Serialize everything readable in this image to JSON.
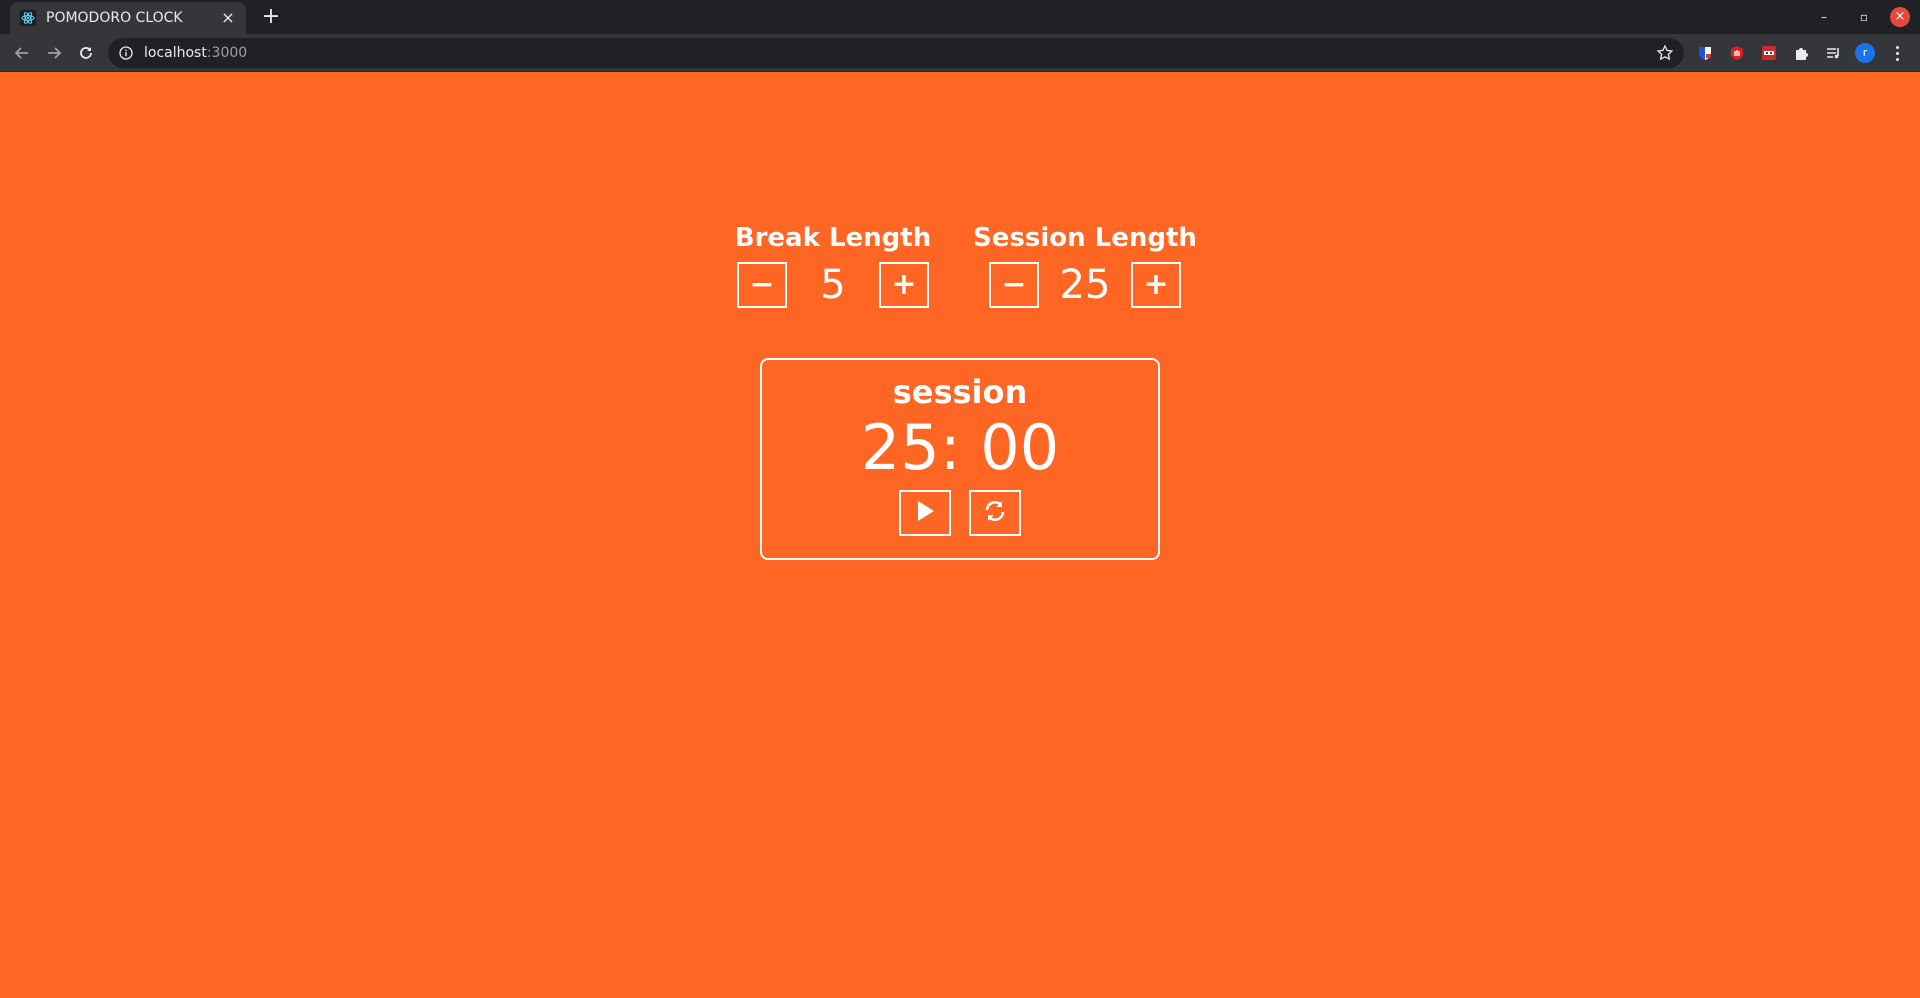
{
  "browser": {
    "tab_title": "POMODORO CLOCK",
    "tab_close": "×",
    "new_tab": "+",
    "url_host": "localhost",
    "url_port": ":3000",
    "avatar_initial": "r",
    "icons": {
      "favicon": "react-icon",
      "back": "back-arrow-icon",
      "forward": "forward-arrow-icon",
      "reload": "reload-icon",
      "info": "info-icon",
      "bookmark": "star-icon",
      "extensions": [
        "extension-shield-icon",
        "extension-hand-icon",
        "extension-ninja-icon",
        "puzzle-icon",
        "media-queue-icon"
      ]
    },
    "window_controls": {
      "minimize": "–",
      "restore": "▫",
      "close": "×"
    }
  },
  "colors": {
    "page_background": "#ff6523",
    "foreground": "#ffffff"
  },
  "break_control": {
    "title": "Break Length",
    "decrement": "−",
    "value": "5",
    "increment": "+"
  },
  "session_control": {
    "title": "Session Length",
    "decrement": "−",
    "value": "25",
    "increment": "+"
  },
  "timer": {
    "label": "session",
    "time": "25: 00",
    "icons": {
      "start": "play-icon",
      "reset": "refresh-icon"
    }
  }
}
